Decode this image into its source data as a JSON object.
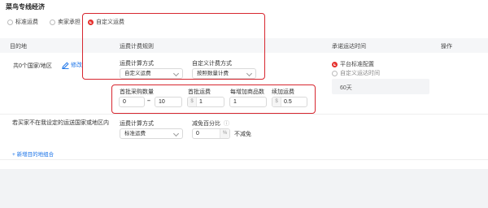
{
  "title": "菜鸟专线经济",
  "mode_options": [
    {
      "label": "标准运费",
      "selected": false
    },
    {
      "label": "卖家承担",
      "selected": false
    },
    {
      "label": "自定义运费",
      "selected": true
    }
  ],
  "table": {
    "headers": [
      "目的地",
      "运费计费规则",
      "承诺运达时间",
      "操作"
    ]
  },
  "row1": {
    "destination": "共0个国家/地区",
    "edit_label": "修改",
    "calc_method_label": "运费计算方式",
    "calc_method_value": "自定义运费",
    "custom_method_label": "自定义计费方式",
    "custom_method_value": "按照数量计费",
    "qty_label": "首批采购数量",
    "qty_from": "0",
    "qty_to": "10",
    "first_fee_label": "首批运费",
    "first_fee_prefix": "$",
    "first_fee_value": "1",
    "each_add_label": "每增加商品数",
    "each_add_value": "1",
    "add_fee_label": "续加运费",
    "add_fee_prefix": "$",
    "add_fee_value": "0.5",
    "delivery_option1": "平台标准配置",
    "delivery_option2": "自定义运达时间",
    "delivery_days": "60天"
  },
  "row2": {
    "destination": "若买家不在我设定的运送国家或地区内",
    "calc_method_label": "运费计算方式",
    "calc_method_value": "标准运费",
    "discount_label": "减免百分比",
    "discount_value": "0",
    "discount_suffix": "%",
    "no_discount": "不减免"
  },
  "add_destination": "+ 新增目的地组合",
  "colors": {
    "highlight": "#d7262f",
    "link": "#1a73e8",
    "radio_on": "#e5302d"
  }
}
